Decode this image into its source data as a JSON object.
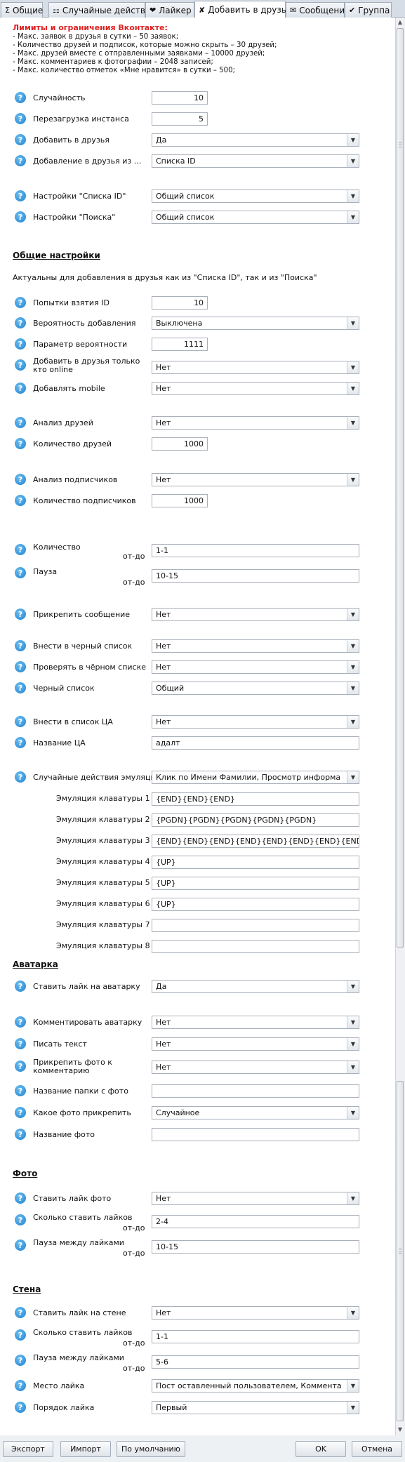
{
  "tabs": [
    {
      "icon": "Σ",
      "icon_name": "sigma-icon",
      "label": "Общие"
    },
    {
      "icon": "⚏",
      "icon_name": "random-actions-icon",
      "label": "Случайные действия"
    },
    {
      "icon": "❤",
      "icon_name": "heart-icon",
      "label": "Лайкер"
    },
    {
      "icon": "✘",
      "icon_name": "add-friends-icon",
      "label": "Добавить в друзья"
    },
    {
      "icon": "✉",
      "icon_name": "mail-icon",
      "label": "Сообщения"
    },
    {
      "icon": "✔",
      "icon_name": "check-icon",
      "label": "Группа"
    }
  ],
  "limits": {
    "title": "Лимиты и ограничения Вконтакте:",
    "lines": [
      "- Макс. заявок в друзья в сутки – 50 заявок;",
      "- Количество друзей и подписок, которые можно скрыть – 30 друзей;",
      "- Макс. друзей вместе с отправленными заявками – 10000 друзей;",
      "- Макс. комментариев к фотографии – 2048 записей;",
      "- Макс. количество отметок «Мне нравится» в сутки – 500;"
    ]
  },
  "fields": {
    "randomness": {
      "label": "Случайность",
      "value": "10"
    },
    "reload_instance": {
      "label": "Перезагрузка инстанса",
      "value": "5"
    },
    "add_friends": {
      "label": "Добавить в друзья",
      "value": "Да"
    },
    "add_friends_from": {
      "label": "Добавление в друзья из ...",
      "value": "Списка ID"
    },
    "list_id_settings": {
      "label": "Настройки \"Списка ID\"",
      "value": "Общий список"
    },
    "search_settings": {
      "label": "Настройки \"Поиска\"",
      "value": "Общий список"
    }
  },
  "general": {
    "heading": "Общие настройки",
    "desc": "Актуальны для добавления в друзья как из \"Списка ID\", так и из \"Поиска\"",
    "id_attempts": {
      "label": "Попытки взятия ID",
      "value": "10"
    },
    "add_probability": {
      "label": "Вероятность добавления",
      "value": "Выключена"
    },
    "probability_param": {
      "label": "Параметр вероятности",
      "value": "1111"
    },
    "only_online": {
      "label": "Добавить в друзья только кто online",
      "value": "Нет"
    },
    "add_mobile": {
      "label": "Добавлять mobile",
      "value": "Нет"
    },
    "friends_analysis": {
      "label": "Анализ друзей",
      "value": "Нет"
    },
    "friends_count": {
      "label": "Количество друзей",
      "value": "1000"
    },
    "subscribers_analysis": {
      "label": "Анализ подписчиков",
      "value": "Нет"
    },
    "subscribers_count": {
      "label": "Количество подписчиков",
      "value": "1000"
    },
    "quantity": {
      "label": "Количество",
      "range_label": "от-до",
      "value": "1-1"
    },
    "pause": {
      "label": "Пауза",
      "range_label": "от-до",
      "value": "10-15"
    },
    "attach_message": {
      "label": "Прикрепить сообщение",
      "value": "Нет"
    },
    "blacklist_add": {
      "label": "Внести в черный список",
      "value": "Нет"
    },
    "blacklist_check": {
      "label": "Проверять в чёрном списке",
      "value": "Нет"
    },
    "blacklist": {
      "label": "Черный список",
      "value": "Общий"
    },
    "ta_add": {
      "label": "Внести в список ЦА",
      "value": "Нет"
    },
    "ta_name": {
      "label": "Название ЦА",
      "value": "адалт"
    },
    "emulation_actions": {
      "label": "Случайные действия эмуляции",
      "value": "Клик по Имени Фамилии, Просмотр информации ак..."
    },
    "kbd": [
      {
        "label": "Эмуляция клаватуры 1",
        "value": "{END}{END}{END}"
      },
      {
        "label": "Эмуляция клаватуры 2",
        "value": "{PGDN}{PGDN}{PGDN}{PGDN}{PGDN}"
      },
      {
        "label": "Эмуляция клаватуры 3",
        "value": "{END}{END}{END}{END}{END}{END}{END}{END}{END}"
      },
      {
        "label": "Эмуляция клаватуры 4",
        "value": "{UP}"
      },
      {
        "label": "Эмуляция клаватуры 5",
        "value": "{UP}"
      },
      {
        "label": "Эмуляция клаватуры 6",
        "value": "{UP}"
      },
      {
        "label": "Эмуляция клаватуры 7",
        "value": ""
      },
      {
        "label": "Эмуляция клаватуры 8",
        "value": ""
      }
    ]
  },
  "avatar": {
    "heading": "Аватарка",
    "like_avatar": {
      "label": "Ставить лайк на аватарку",
      "value": "Да"
    },
    "comment_avatar": {
      "label": "Комментировать аватарку",
      "value": "Нет"
    },
    "write_text": {
      "label": "Писать текст",
      "value": "Нет"
    },
    "attach_photo": {
      "label": "Прикрепить фото к комментарию",
      "value": "Нет"
    },
    "photo_folder": {
      "label": "Название папки с фото",
      "value": ""
    },
    "which_photo": {
      "label": "Какое фото прикрепить",
      "value": "Случайное"
    },
    "photo_name": {
      "label": "Название фото",
      "value": ""
    }
  },
  "photo": {
    "heading": "Фото",
    "like_photo": {
      "label": "Ставить лайк фото",
      "value": "Нет"
    },
    "likes_count": {
      "label": "Сколько ставить лайков",
      "range_label": "от-до",
      "value": "2-4"
    },
    "likes_pause": {
      "label": "Пауза между лайками",
      "range_label": "от-до",
      "value": "10-15"
    }
  },
  "wall": {
    "heading": "Стена",
    "like_wall": {
      "label": "Ставить лайк на стене",
      "value": "Нет"
    },
    "likes_count": {
      "label": "Сколько ставить лайков",
      "range_label": "от-до",
      "value": "1-1"
    },
    "likes_pause": {
      "label": "Пауза между лайками",
      "range_label": "от-до",
      "value": "5-6"
    },
    "like_place": {
      "label": "Место лайка",
      "value": "Пост оставленный пользователем, Комментарий о..."
    },
    "like_order": {
      "label": "Порядок лайка",
      "value": "Первый"
    }
  },
  "footer": {
    "export": "Экспорт",
    "import": "Импорт",
    "default": "По умолчанию",
    "ok": "OK",
    "cancel": "Отмена"
  },
  "help_glyph": "?",
  "dropdown_glyph": "▼",
  "colors": {
    "accent_help": "#1f7fcf",
    "limits_title": "#e02020",
    "tab_bar": "#d6dde6"
  }
}
